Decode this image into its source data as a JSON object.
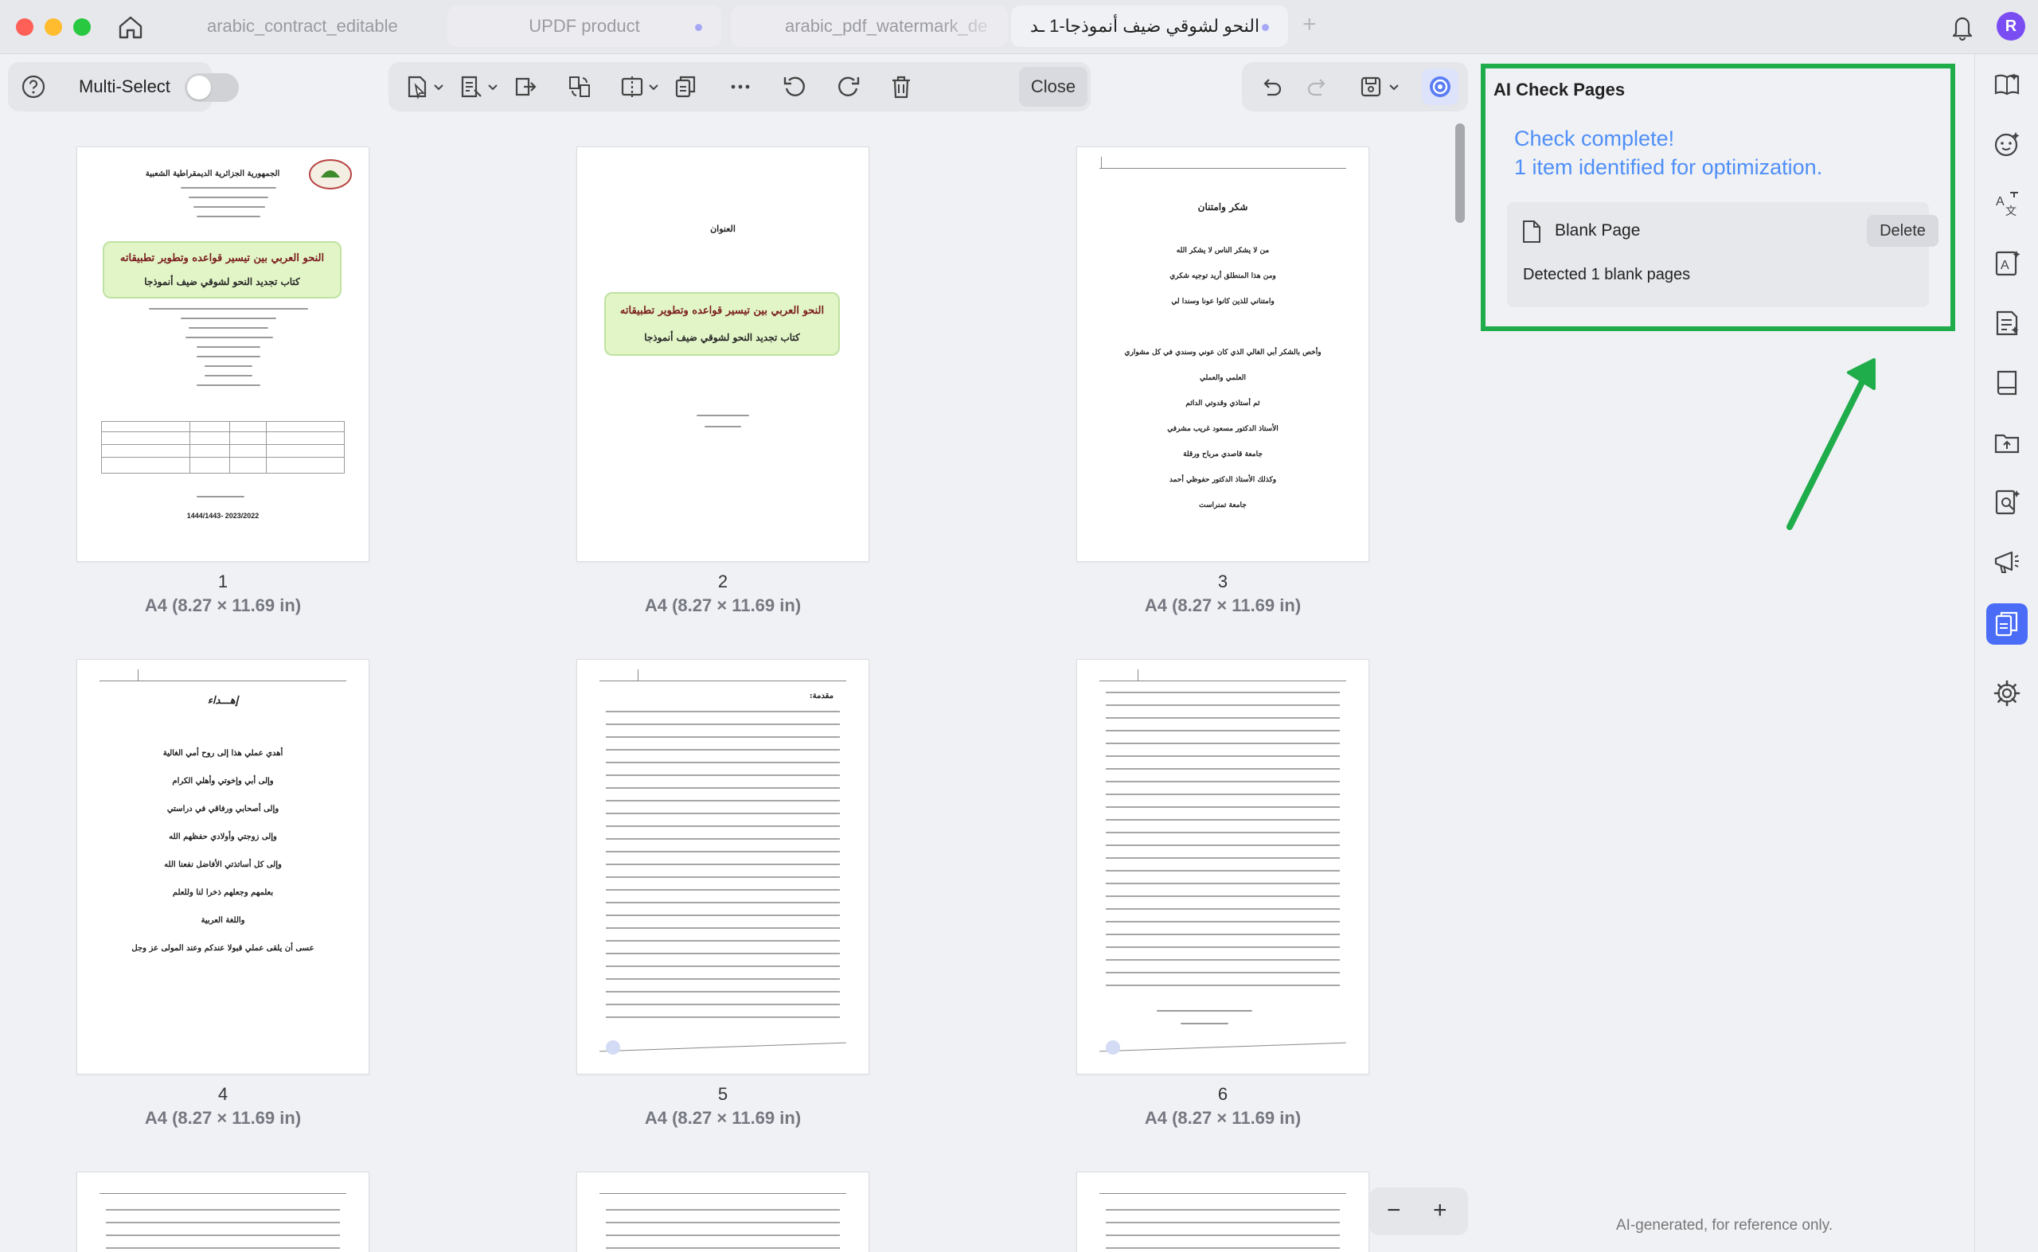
{
  "tabs": [
    {
      "label": "arabic_contract_editable",
      "active": false,
      "modified": false
    },
    {
      "label": "UPDF product",
      "active": false,
      "modified": true
    },
    {
      "label": "arabic_pdf_watermark_de",
      "active": false,
      "modified": false
    },
    {
      "label": "النحو لشوقي ضيف أنموذجا-1 ـد",
      "active": true,
      "modified": true
    }
  ],
  "account_initial": "R",
  "toolbar": {
    "multi_select_label": "Multi-Select",
    "multi_select_on": false,
    "close_label": "Close"
  },
  "pages": [
    {
      "number": "1",
      "size": "A4 (8.27 × 11.69 in)"
    },
    {
      "number": "2",
      "size": "A4 (8.27 × 11.69 in)"
    },
    {
      "number": "3",
      "size": "A4 (8.27 × 11.69 in)"
    },
    {
      "number": "4",
      "size": "A4 (8.27 × 11.69 in)"
    },
    {
      "number": "5",
      "size": "A4 (8.27 × 11.69 in)"
    },
    {
      "number": "6",
      "size": "A4 (8.27 × 11.69 in)"
    }
  ],
  "page_text": {
    "p1_title": "النحو العربي بين تيسير قواعده وتطوير تطبيقاته",
    "p1_subtitle": "كتاب تجديد النحو لشوقي ضيف أنموذجا",
    "p1_header": "الجمهورية الجزائرية الديمقراطية الشعبية",
    "p1_year": "1444/1443- 2023/2022",
    "p2_heading": "العنوان",
    "p2_title": "النحو العربي بين تيسير قواعده وتطوير تطبيقاته",
    "p2_subtitle": "كتاب تجديد النحو لشوقي ضيف أنموذجا",
    "p3_heading": "شكر وامتنان",
    "p3_lines": [
      "من لا يشكر الناس لا يشكر الله",
      "ومن هذا المنطلق أريد توجيه شكري",
      "وامتناني للذين كانوا عونا وسندا لي",
      "وأخص بالشكر أبي الغالي الذي كان عوني وسندي في كل مشواري",
      "العلمي والعملي",
      "ثم أستاذي وقدوتي الدائم",
      "الأستاذ الدكتور مسعود غريب مشرفي",
      "جامعة قاصدي مرباح ورقلة",
      "وكذلك الأستاذ الدكتور حفوظي أحمد",
      "جامعة تمنراست"
    ],
    "p4_heading": "إهـــداء",
    "p4_lines": [
      "أهدي عملي هذا إلى روح أمي الغالية",
      "وإلى أبي وإخوتي وأهلي الكرام",
      "وإلى أصحابي ورفاقي في دراستي",
      "وإلى زوجتي وأولادي حفظهم الله",
      "وإلى كل أساتذتي الأفاضل نفعنا الله",
      "بعلمهم وجعلهم ذخرا لنا وللعلم",
      "واللغة العربية",
      "عسى أن يلقى عملي قبولا عندكم وعند المولى عز وجل"
    ],
    "p5_heading": "مقدمة:"
  },
  "ai_panel": {
    "title": "AI Check Pages",
    "status_line1": "Check complete!",
    "status_line2": "1 item identified for optimization.",
    "item_label": "Blank Page",
    "delete_label": "Delete",
    "detail": "Detected 1 blank pages",
    "footer": "AI-generated, for reference only."
  },
  "colors": {
    "accent": "#4a6cf7",
    "highlight_border": "#1fac4a",
    "status_text": "#4f8ff7",
    "avatar": "#7a4df3"
  }
}
